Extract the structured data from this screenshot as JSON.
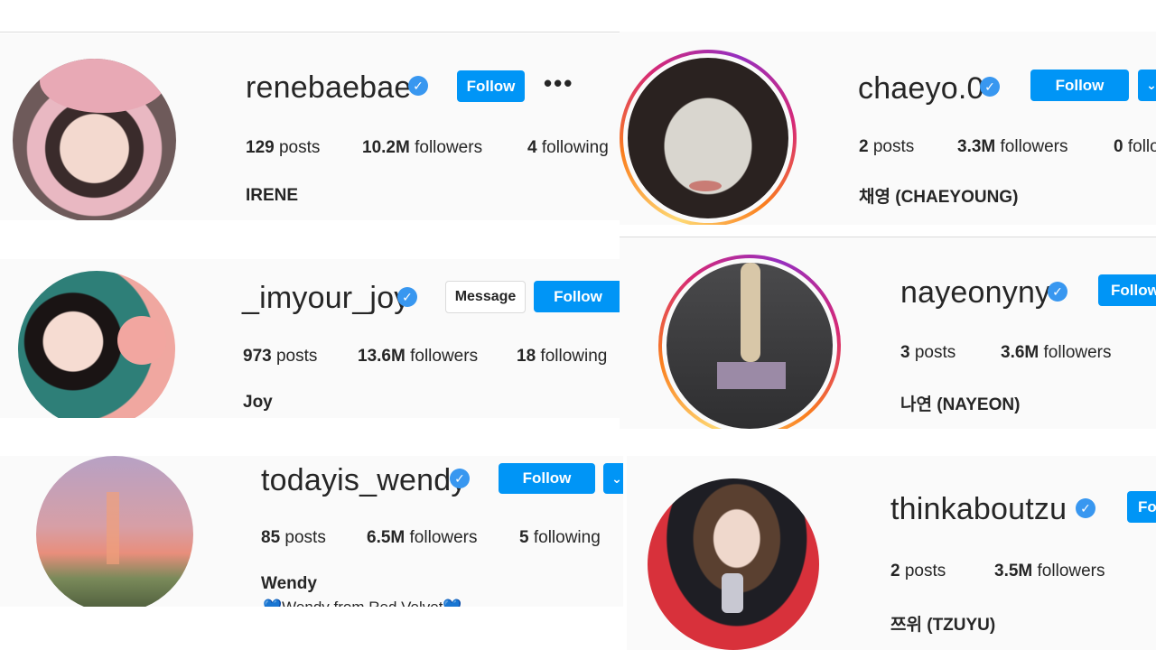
{
  "profiles": {
    "irene": {
      "username": "renebaebae",
      "verified_icon": "verified-badge",
      "follow": "Follow",
      "more": "•••",
      "posts_count": "129",
      "posts_label": "posts",
      "followers_count": "10.2M",
      "followers_label": "followers",
      "following_count": "4",
      "following_label": "following",
      "fullname": "IRENE"
    },
    "joy": {
      "username": "_imyour_joy",
      "verified_icon": "verified-badge",
      "message": "Message",
      "follow": "Follow",
      "posts_count": "973",
      "posts_label": "posts",
      "followers_count": "13.6M",
      "followers_label": "followers",
      "following_count": "18",
      "following_label": "following",
      "fullname": "Joy"
    },
    "wendy": {
      "username": "todayis_wendy",
      "verified_icon": "verified-badge",
      "follow": "Follow",
      "posts_count": "85",
      "posts_label": "posts",
      "followers_count": "6.5M",
      "followers_label": "followers",
      "following_count": "5",
      "following_label": "following",
      "fullname": "Wendy",
      "bio": "💙Wendy from Red Velvet💙"
    },
    "chaeyoung": {
      "username": "chaeyo.0",
      "verified_icon": "verified-badge",
      "follow": "Follow",
      "posts_count": "2",
      "posts_label": "posts",
      "followers_count": "3.3M",
      "followers_label": "followers",
      "following_count": "0",
      "following_label": "follo",
      "fullname": "채영 (CHAEYOUNG)"
    },
    "nayeon": {
      "username": "nayeonyny",
      "verified_icon": "verified-badge",
      "follow": "Follow",
      "posts_count": "3",
      "posts_label": "posts",
      "followers_count": "3.6M",
      "followers_label": "followers",
      "fullname": "나연 (NAYEON)"
    },
    "tzuyu": {
      "username": "thinkaboutzu",
      "verified_icon": "verified-badge",
      "follow": "Fo",
      "posts_count": "2",
      "posts_label": "posts",
      "followers_count": "3.5M",
      "followers_label": "followers",
      "fullname": "쯔위 (TZUYU)"
    }
  },
  "colors": {
    "follow_button": "#0095f6",
    "verified": "#3897f0",
    "story_ring": "#d62976"
  }
}
